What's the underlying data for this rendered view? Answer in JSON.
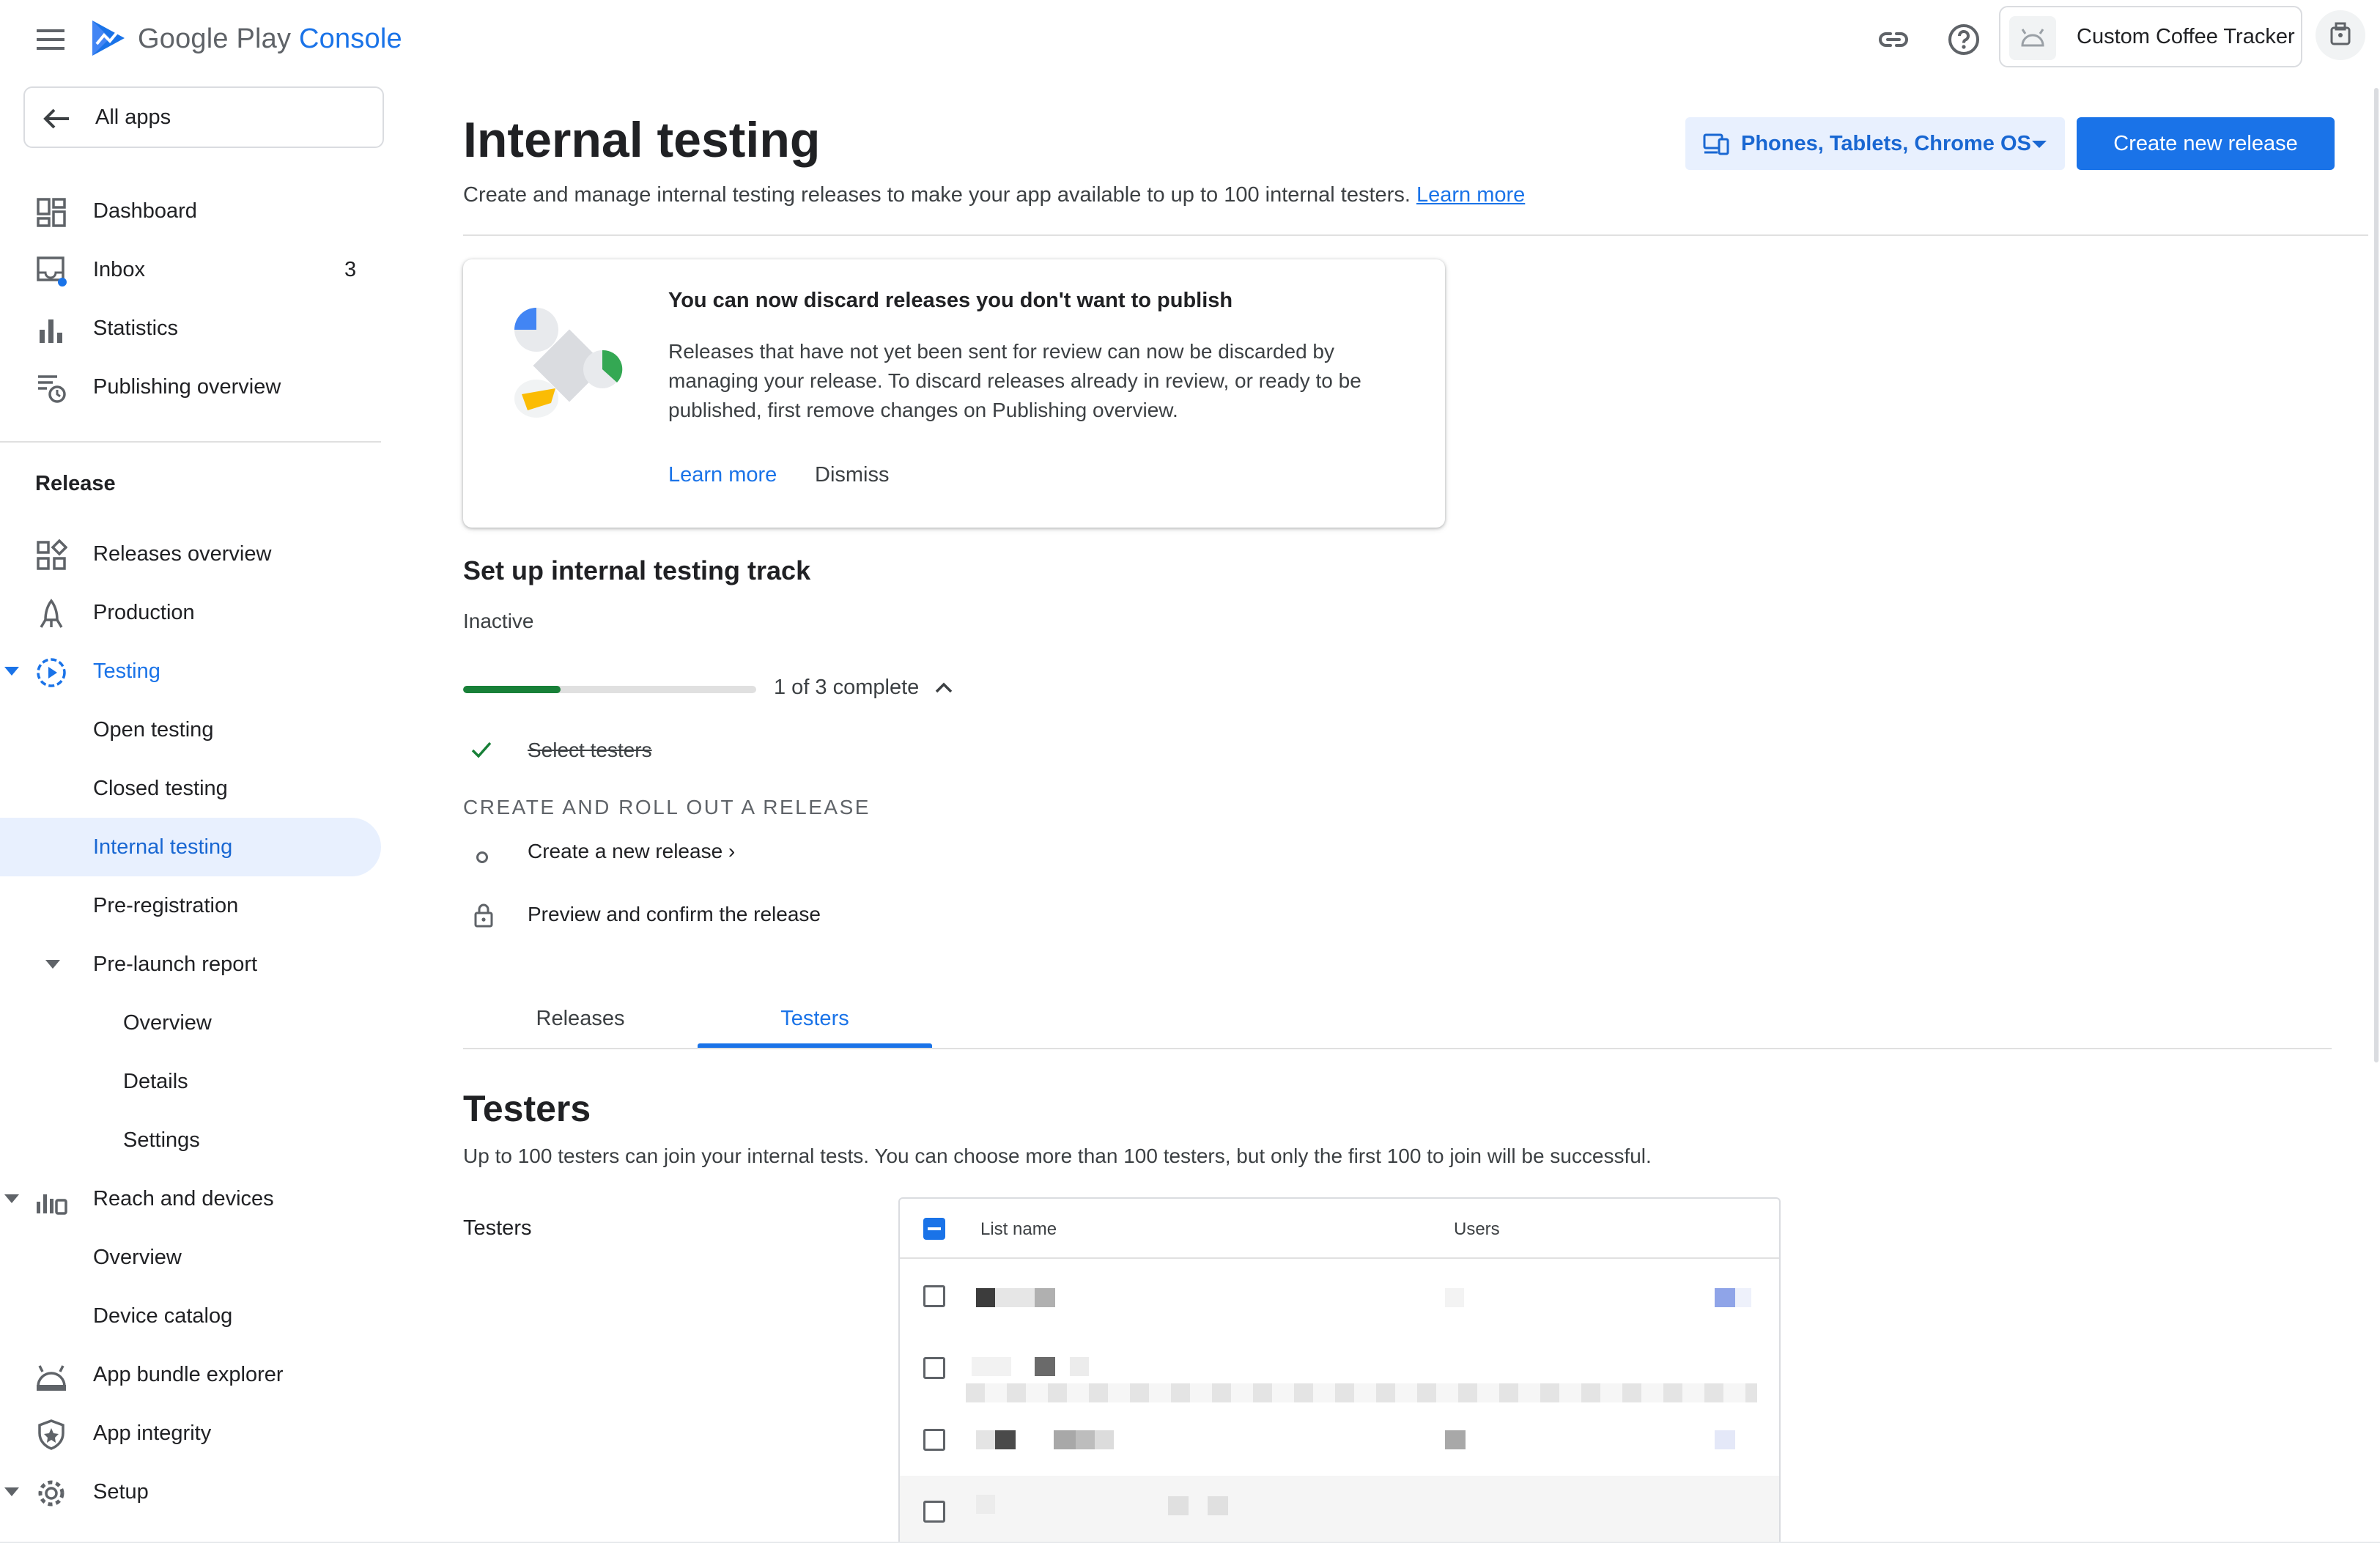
{
  "header": {
    "brand_google_play": "Google Play",
    "brand_console": "Console",
    "app_name": "Custom Coffee Tracker"
  },
  "sidebar": {
    "all_apps": "All apps",
    "items": [
      {
        "label": "Dashboard"
      },
      {
        "label": "Inbox",
        "count": "3"
      },
      {
        "label": "Statistics"
      },
      {
        "label": "Publishing overview"
      }
    ],
    "section_release": "Release",
    "release_items": [
      {
        "label": "Releases overview"
      },
      {
        "label": "Production"
      },
      {
        "label": "Testing"
      },
      {
        "label": "Open testing"
      },
      {
        "label": "Closed testing"
      },
      {
        "label": "Internal testing"
      },
      {
        "label": "Pre-registration"
      },
      {
        "label": "Pre-launch report"
      },
      {
        "label": "Overview"
      },
      {
        "label": "Details"
      },
      {
        "label": "Settings"
      },
      {
        "label": "Reach and devices"
      },
      {
        "label": "Overview"
      },
      {
        "label": "Device catalog"
      },
      {
        "label": "App bundle explorer"
      },
      {
        "label": "App integrity"
      },
      {
        "label": "Setup"
      }
    ]
  },
  "main": {
    "title": "Internal testing",
    "subtitle": "Create and manage internal testing releases to make your app available to up to 100 internal testers.",
    "learn_more": "Learn more",
    "device_filter": "Phones, Tablets, Chrome OS",
    "create_button": "Create new release",
    "notice": {
      "title": "You can now discard releases you don't want to publish",
      "body": "Releases that have not yet been sent for review can now be discarded by managing your release. To discard releases already in review, or ready to be published, first remove changes on Publishing overview.",
      "learn_more": "Learn more",
      "dismiss": "Dismiss"
    },
    "setup": {
      "title": "Set up internal testing track",
      "status": "Inactive",
      "progress_fraction": 0.333,
      "progress_label": "1 of 3 complete",
      "step_done": "Select testers",
      "section": "CREATE AND ROLL OUT A RELEASE",
      "step_new_release": "Create a new release ›",
      "step_preview": "Preview and confirm the release"
    },
    "tabs": [
      "Releases",
      "Testers"
    ],
    "testers": {
      "title": "Testers",
      "description": "Up to 100 testers can join your internal tests. You can choose more than 100 testers, but only the first 100 to join will be successful.",
      "label": "Testers",
      "col_list_name": "List name",
      "col_users": "Users"
    }
  },
  "colors": {
    "accent": "#1a73e8",
    "progress": "#188038",
    "selected_bg": "#e8f0fe"
  }
}
